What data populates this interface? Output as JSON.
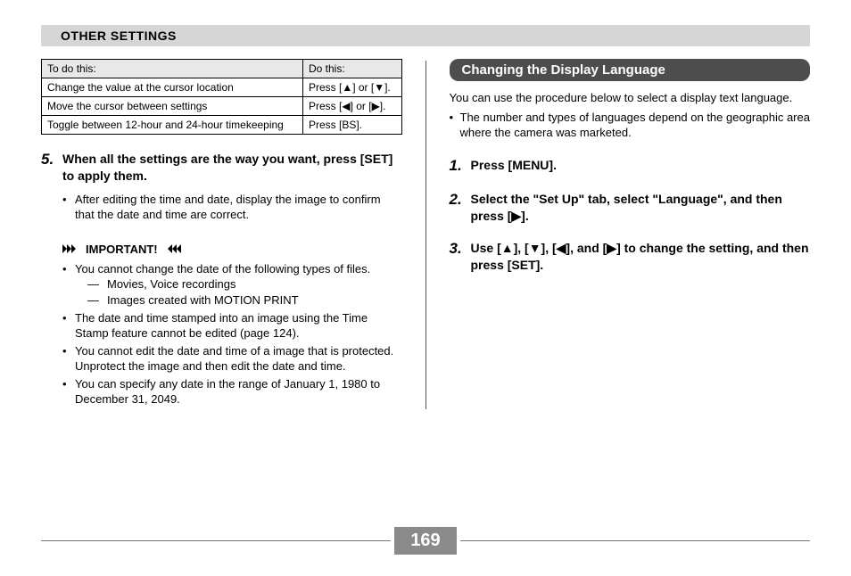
{
  "header": "OTHER SETTINGS",
  "table": {
    "head": [
      "To do this:",
      "Do this:"
    ],
    "rows": [
      [
        "Change the value at the cursor location",
        "Press [▲] or [▼]."
      ],
      [
        "Move the cursor between settings",
        "Press [◀] or [▶]."
      ],
      [
        "Toggle between 12-hour and 24-hour timekeeping",
        "Press [BS]."
      ]
    ]
  },
  "step5": {
    "num": "5.",
    "title": "When all the settings are the way you want, press [SET] to apply them.",
    "sub": "After editing the time and date, display the image to confirm that the date and time are correct."
  },
  "important": {
    "label": "IMPORTANT!",
    "items": [
      {
        "text": "You cannot change the date of the following types of files.",
        "dashes": [
          "Movies, Voice recordings",
          "Images created with MOTION PRINT"
        ]
      },
      {
        "text": "The date and time stamped into an image using the Time Stamp feature cannot be edited (page 124)."
      },
      {
        "text": "You cannot edit the date and time of a image that is protected. Unprotect the image and then edit the date and time."
      },
      {
        "text": "You can specify any date in the range of January 1, 1980 to December 31, 2049."
      }
    ]
  },
  "right": {
    "heading": "Changing the Display Language",
    "intro": "You can use the procedure below to select a display text language.",
    "intro_sub": "The number and types of languages depend on the geographic area where the camera was marketed.",
    "steps": [
      {
        "num": "1.",
        "title": "Press [MENU]."
      },
      {
        "num": "2.",
        "title": "Select the \"Set Up\" tab, select \"Language\", and then press [▶]."
      },
      {
        "num": "3.",
        "title": "Use [▲], [▼], [◀], and [▶] to change the setting, and then press [SET]."
      }
    ]
  },
  "page_number": "169"
}
